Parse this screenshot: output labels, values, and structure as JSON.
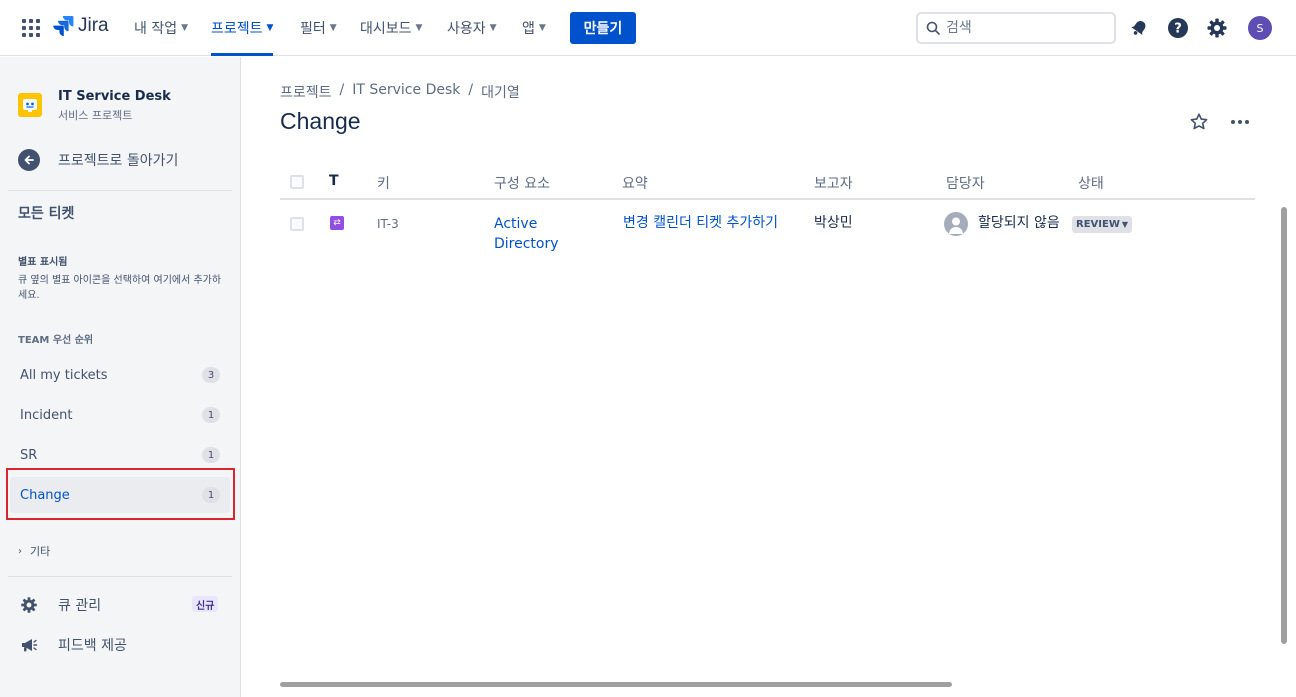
{
  "topnav": {
    "logo_text": "Jira",
    "items": [
      {
        "label": "내 작업"
      },
      {
        "label": "프로젝트"
      },
      {
        "label": "필터"
      },
      {
        "label": "대시보드"
      },
      {
        "label": "사용자"
      },
      {
        "label": "앱"
      }
    ],
    "active_item": "프로젝트",
    "create_label": "만들기",
    "search_placeholder": "검색",
    "avatar_initial": "S",
    "icons": [
      "apps-grid-icon",
      "notification-bell-icon",
      "help-icon",
      "settings-gear-icon"
    ]
  },
  "sidebar": {
    "project_name": "IT Service Desk",
    "project_type": "서비스 프로젝트",
    "back_label": "프로젝트로 돌아가기",
    "all_tickets_label": "모든 티켓",
    "starred_title": "별표 표시됨",
    "starred_desc": "큐 옆의 별표 아이콘을 선택하여 여기에서 추가하세요.",
    "team_title": "TEAM 우선 순위",
    "queues": [
      {
        "label": "All my tickets",
        "count": "3"
      },
      {
        "label": "Incident",
        "count": "1"
      },
      {
        "label": "SR",
        "count": "1"
      },
      {
        "label": "Change",
        "count": "1"
      }
    ],
    "selected_queue": "Change",
    "other_label": "기타",
    "manage_queues_label": "큐 관리",
    "new_badge": "신규",
    "feedback_label": "피드백 제공"
  },
  "main": {
    "breadcrumb": [
      "프로젝트",
      "IT Service Desk",
      "대기열"
    ],
    "breadcrumb_sep": "/",
    "title": "Change",
    "columns": {
      "type": "T",
      "key": "키",
      "component": "구성 요소",
      "summary": "요약",
      "reporter": "보고자",
      "assignee": "담당자",
      "status": "상태"
    },
    "rows": [
      {
        "key": "IT-3",
        "component": "Active Directory",
        "summary": "변경 캘린더 티켓 추가하기",
        "reporter": "박상민",
        "assignee": "할당되지 않음",
        "status": "REVIEW"
      }
    ]
  },
  "colors": {
    "accent": "#0052cc",
    "highlight_border": "#d9262e",
    "change_type": "#904ee2",
    "project_icon": "#ffc400"
  }
}
